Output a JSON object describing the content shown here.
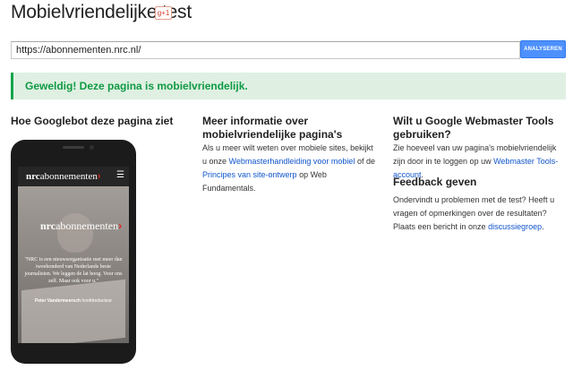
{
  "header": {
    "title": "Mobielvriendelijke test",
    "gplus_label": "g+1"
  },
  "search": {
    "url_value": "https://abonnementen.nrc.nl/",
    "button_label": "ANALYSEREN"
  },
  "result": {
    "message": "Geweldig! Deze pagina is mobielvriendelijk."
  },
  "colors": {
    "accent_blue": "#4d90fe",
    "success_green": "#14a44d",
    "banner_bg": "#dff0e2",
    "link": "#1155cc"
  },
  "left_column": {
    "heading": "Hoe Googlebot deze pagina ziet",
    "phone": {
      "logo_nrc": "nrc",
      "logo_rest": "abonnementen",
      "logo_chevron": "›",
      "menu_icon": "menu-icon",
      "quote": "\"NRC is een nieuwsorganisatie met meer dan tweehonderd van Nederlands beste journalisten. We leggen de lat hoog. Voor ons zelf. Maar ook voor u.\"",
      "author_name": "Peter Vandermeersch",
      "author_role": "hoofdredacteur"
    }
  },
  "middle_column": {
    "heading": "Meer informatie over mobielvriendelijke pagina's",
    "text_1": "Als u meer wilt weten over mobiele sites, bekijkt u onze ",
    "link_1": "Webmasterhandleiding voor mobiel",
    "text_2": " of de ",
    "link_2": "Principes van site-ontwerp",
    "text_3": " op Web Fundamentals."
  },
  "right_column": {
    "heading": "Wilt u Google Webmaster Tools gebruiken?",
    "text_1": "Zie hoeveel van uw pagina's mobielvriendelijk zijn door in te loggen op uw ",
    "link_1": "Webmaster Tools-account",
    "text_2": ".",
    "feedback_heading": "Feedback geven",
    "feedback_text": "Ondervindt u problemen met de test? Heeft u vragen of opmerkingen over de resultaten? Plaats een bericht in onze ",
    "feedback_link": "discussiegroep",
    "feedback_end": "."
  }
}
